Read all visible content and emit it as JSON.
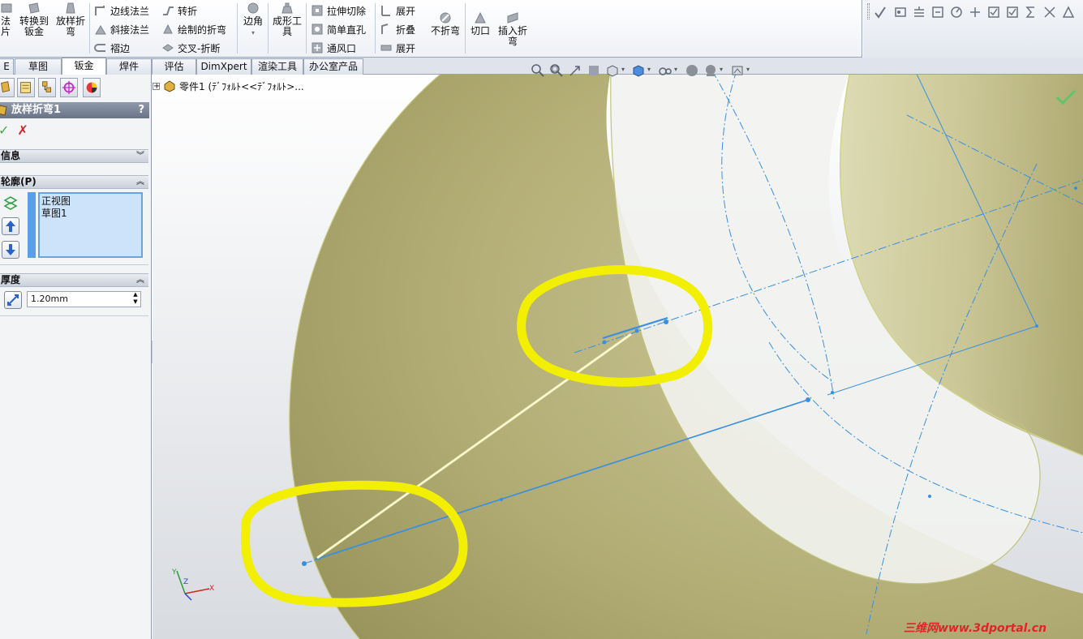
{
  "ribbon": {
    "big_buttons": [
      {
        "label_line1": "法",
        "label_line2": "片"
      },
      {
        "label_line1": "转换到",
        "label_line2": "钣金"
      },
      {
        "label_line1": "放样折",
        "label_line2": "弯"
      },
      {
        "label_line1": "边角",
        "label_line2": ""
      },
      {
        "label_line1": "成形工",
        "label_line2": "具"
      },
      {
        "label_line1": "不折弯",
        "label_line2": ""
      },
      {
        "label_line1": "切口",
        "label_line2": ""
      },
      {
        "label_line1": "插入折",
        "label_line2": "弯"
      }
    ],
    "small_buttons": [
      "边线法兰",
      "斜接法兰",
      "褶边",
      "转折",
      "绘制的折弯",
      "交叉-折断",
      "拉伸切除",
      "简单直孔",
      "通风口",
      "展开",
      "折叠",
      "展开"
    ]
  },
  "tabs": [
    "E",
    "草图",
    "钣金",
    "焊件",
    "评估",
    "DimXpert",
    "渲染工具",
    "办公室产品"
  ],
  "active_tab": "钣金",
  "panel": {
    "title": "放样折弯1",
    "help": "?",
    "ok_symbol": "✓",
    "cancel_symbol": "✗",
    "groups": {
      "info": "信息",
      "profile": "轮廓(P)",
      "thickness": "厚度"
    },
    "profiles": [
      "正视图",
      "草图1"
    ],
    "thickness_value": "1.20mm"
  },
  "feature_tree": {
    "expander": "+",
    "label": "零件1 (ﾃﾞﾌｫﾙﾄ<<ﾃﾞﾌｫﾙﾄ>..."
  },
  "watermark": "三维网www.3dportal.cn",
  "colors": {
    "surface": "#b8b376",
    "highlight": "#f2ef00",
    "sketch": "#3a8fe0",
    "accept": "#3cb043",
    "cancel": "#d42020"
  }
}
